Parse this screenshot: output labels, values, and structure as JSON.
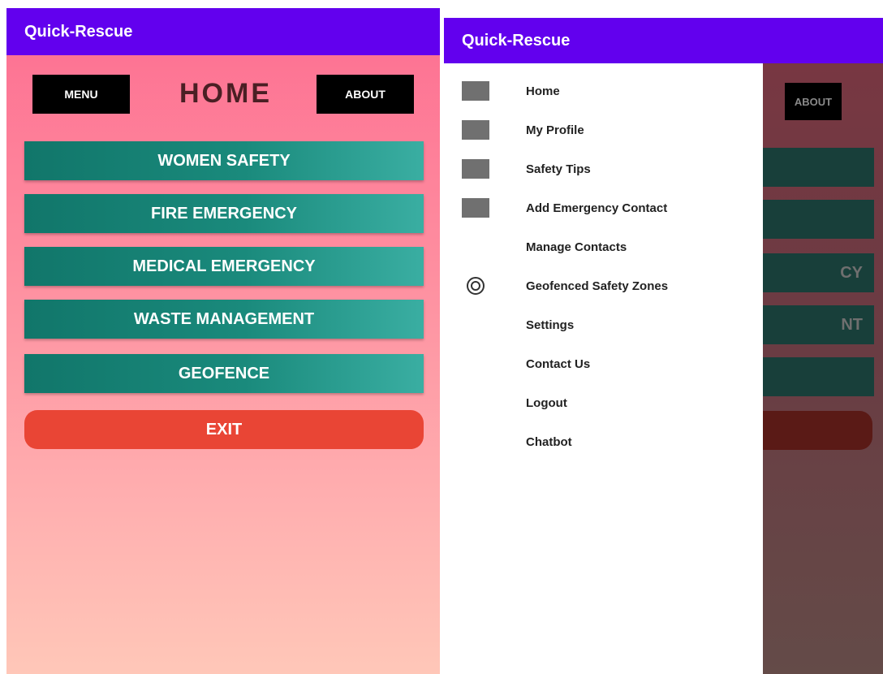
{
  "app_title": "Quick-Rescue",
  "home": {
    "menu_label": "MENU",
    "title": "HOME",
    "about_label": "ABOUT",
    "features": [
      {
        "label": "WOMEN SAFETY"
      },
      {
        "label": "FIRE EMERGENCY"
      },
      {
        "label": "MEDICAL EMERGENCY"
      },
      {
        "label": "WASTE MANAGEMENT"
      },
      {
        "label": "GEOFENCE"
      }
    ],
    "exit_label": "EXIT"
  },
  "drawer_view": {
    "about_label": "ABOUT",
    "partial_feature_text": [
      "",
      "",
      "CY",
      "NT",
      ""
    ],
    "items": [
      {
        "label": "Home",
        "icon": "square-icon"
      },
      {
        "label": "My Profile",
        "icon": "square-icon"
      },
      {
        "label": "Safety Tips",
        "icon": "square-icon"
      },
      {
        "label": "Add Emergency Contact",
        "icon": "square-icon"
      },
      {
        "label": "Manage Contacts",
        "icon": ""
      },
      {
        "label": "Geofenced Safety Zones",
        "icon": "eye-icon"
      },
      {
        "label": "Settings",
        "icon": ""
      },
      {
        "label": "Contact Us",
        "icon": ""
      },
      {
        "label": "Logout",
        "icon": ""
      },
      {
        "label": "Chatbot",
        "icon": ""
      }
    ]
  },
  "colors": {
    "appbar": "#6200ee",
    "feature_button": "#11766a",
    "exit_button": "#e94535"
  }
}
